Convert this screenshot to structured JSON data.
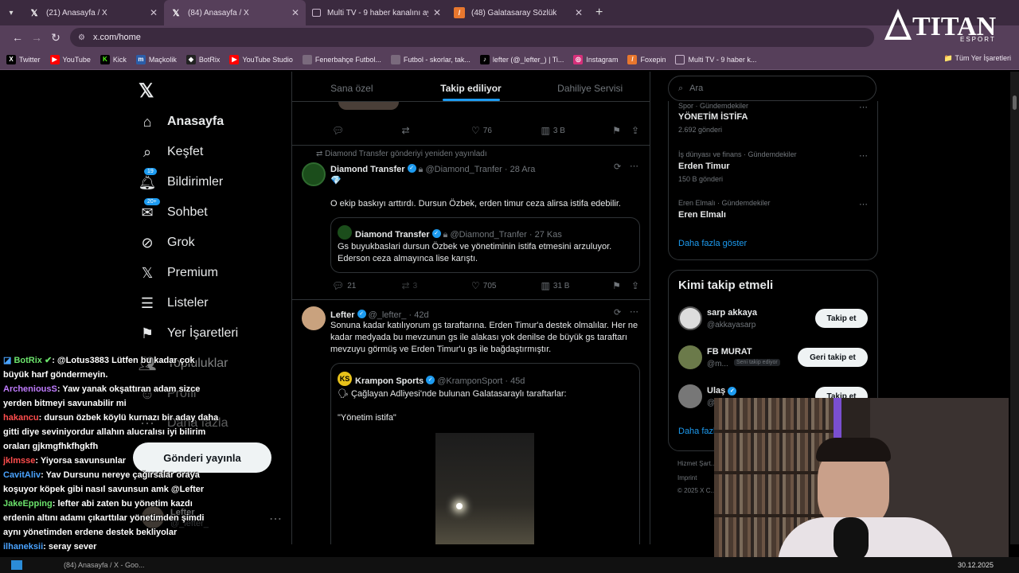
{
  "browser": {
    "tabs": [
      {
        "label": "(21) Anasayfa / X",
        "icon": "x-icon"
      },
      {
        "label": "(84) Anasayfa / X",
        "icon": "x-icon",
        "active": true
      },
      {
        "label": "Multi TV - 9 haber kanalını aynı",
        "icon": "tv-icon"
      },
      {
        "label": "(48) Galatasaray Sözlük",
        "icon": "feather-icon"
      }
    ],
    "url": "x.com/home",
    "bookmarks": [
      "Twitter",
      "YouTube",
      "Kick",
      "Maçkolik",
      "BotRix",
      "YouTube Studio",
      "Fenerbahçe Futbol...",
      "Futbol - skorlar, tak...",
      "lefter (@_lefter_) | Ti...",
      "Instagram",
      "Foxepin",
      "Multi TV - 9 haber k..."
    ],
    "all_bookmarks": "Tüm Yer İşaretleri"
  },
  "nav": {
    "items": [
      "Anasayfa",
      "Keşfet",
      "Bildirimler",
      "Sohbet",
      "Grok",
      "Premium",
      "Listeler",
      "Yer İşaretleri",
      "Topluluklar",
      "Profil",
      "Daha fazla"
    ],
    "notif_badge": "19",
    "chat_badge": "20+",
    "post_button": "Gönderi yayınla",
    "account_name": "Lefter",
    "account_handle": "@_lefter_"
  },
  "tabs": {
    "for_you": "Sana özel",
    "following": "Takip ediliyor",
    "insider": "Dahiliye Servisi"
  },
  "post0": {
    "likes": "76",
    "views": "3 B"
  },
  "post1": {
    "repost_note": "Diamond Transfer gönderiyi yeniden yayınladı",
    "name": "Diamond Transfer",
    "handle": "@Diamond_Tranfer",
    "date": "28 Ara",
    "emoji": "💎",
    "text": "O ekip baskıyı arttırdı. Dursun Özbek,  erden timur ceza alirsa istifa edebilir.",
    "quote_name": "Diamond Transfer",
    "quote_handle": "@Diamond_Tranfer",
    "quote_date": "27 Kas",
    "quote_text": "Gs buyukbaslari dursun Özbek ve yönetiminin istifa etmesini arzuluyor. Ederson ceza almayınca lise karıştı.",
    "replies": "21",
    "reposts": "3",
    "likes": "705",
    "views": "31 B"
  },
  "post2": {
    "name": "Lefter",
    "handle": "@_lefter_",
    "date": "42d",
    "text": "Sonuna kadar katılıyorum gs taraftarına. Erden Timur'a destek olmalılar. Her ne kadar medyada bu mevzunun gs ile alakası yok denilse de büyük gs taraftarı mevzuyu görmüş ve Erden Timur'u gs ile bağdaştırmıştır.",
    "quote_name": "Krampon Sports",
    "quote_handle": "@KramponSport",
    "quote_date": "45d",
    "quote_text": "Çağlayan Adliyesi'nde bulunan Galatasaraylı taraftarlar:",
    "quote_text2": "\"Yönetim istifa\""
  },
  "search": {
    "placeholder": "Ara"
  },
  "trends": [
    {
      "cat": "Spor · Gündemdekiler",
      "name": "YÖNETİM İSTİFA",
      "count": "2.692 gönderi"
    },
    {
      "cat": "İş dünyası ve finans · Gündemdekiler",
      "name": "Erden Timur",
      "count": "150 B gönderi"
    },
    {
      "cat": "Eren Elmalı · Gündemdekiler",
      "name": "Eren Elmalı",
      "count": ""
    }
  ],
  "show_more": "Daha fazla göster",
  "who_to_follow": {
    "title": "Kimi takip etmeli",
    "users": [
      {
        "name": "sarp akkaya",
        "handle": "@akkayasarp",
        "button": "Takip et"
      },
      {
        "name": "FB MURAT",
        "handle": "@m...",
        "note": "Seni takip ediyor",
        "button": "Geri takip et"
      },
      {
        "name": "Ulaş",
        "handle": "@s...",
        "button": "Takip et"
      }
    ],
    "more": "Daha fazla"
  },
  "footer": [
    "Hizmet Şart...",
    "Imprint",
    "© 2025 X C..."
  ],
  "chat": [
    {
      "user": "BotRix",
      "color": "#6be36b",
      "text": ": @Lotus3883 Lütfen bu kadar çok büyük harf göndermeyin."
    },
    {
      "user": "ArcheniousS",
      "color": "#c07cff",
      "text": ": Yaw yanak okşattıran adam sizce yerden bitmeyi savunabilir mi"
    },
    {
      "user": "hakancu",
      "color": "#ff4d4d",
      "text": ": dursun özbek köylü kurnazı bir aday daha gitti diye seviniyordur allahın alucralısı iyi bilirim oraları gjkmgfhkfhgkfh"
    },
    {
      "user": "jklmsse",
      "color": "#ff4d4d",
      "text": ": Yiyorsa savunsunlar"
    },
    {
      "user": "CavitAliv",
      "color": "#4aa3ff",
      "text": ": Yav Dursunu nereye çağırsalar oraya koşuyor köpek gibi nasıl savunsun amk @Lefter"
    },
    {
      "user": "JakeEpping",
      "color": "#6be36b",
      "text": ": lefter abi zaten bu yönetim kazdı erdenin altını adamı çıkarttılar yönetimden şimdi aynı yönetimden erdene destek bekliyolar"
    },
    {
      "user": "ilhaneksii",
      "color": "#4aa3ff",
      "text": ": seray sever"
    }
  ],
  "overlay": {
    "logo": "TITAN",
    "logo_sub": "ESPORT"
  },
  "taskbar": {
    "window": "(84) Anasayfa / X - Goo...",
    "date": "30.12.2025"
  }
}
